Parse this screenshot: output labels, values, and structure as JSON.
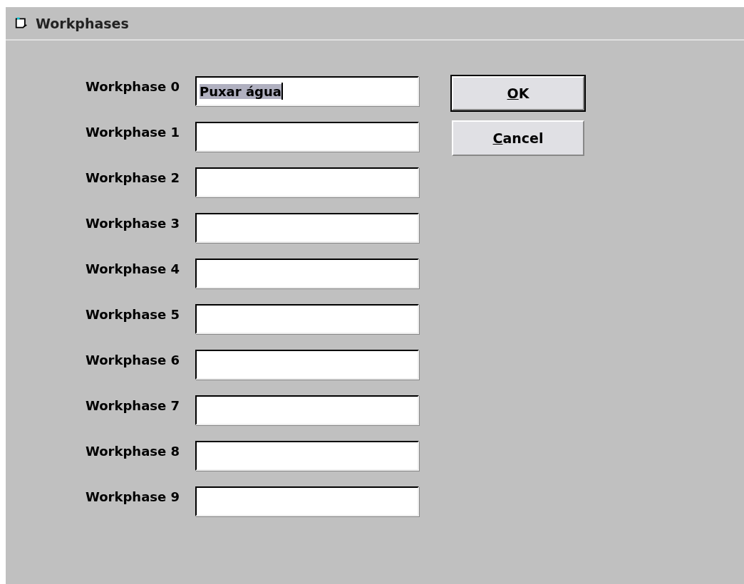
{
  "window": {
    "title": "Workphases"
  },
  "fields": [
    {
      "label": "Workphase 0",
      "value": "Puxar água",
      "text_selected": true
    },
    {
      "label": "Workphase 1",
      "text_selected": false
    },
    {
      "label": "Workphase 2",
      "text_selected": false
    },
    {
      "label": "Workphase 3",
      "text_selected": false
    },
    {
      "label": "Workphase 4",
      "text_selected": false
    },
    {
      "label": "Workphase 5",
      "text_selected": false
    },
    {
      "label": "Workphase 6",
      "text_selected": false
    },
    {
      "label": "Workphase 7",
      "text_selected": false
    },
    {
      "label": "Workphase 8",
      "text_selected": false
    },
    {
      "label": "Workphase 9",
      "text_selected": false
    }
  ],
  "buttons": [
    {
      "mnemonic": "O",
      "rest": "K",
      "default": true
    },
    {
      "mnemonic": "C",
      "rest": "ancel",
      "default": false
    }
  ]
}
